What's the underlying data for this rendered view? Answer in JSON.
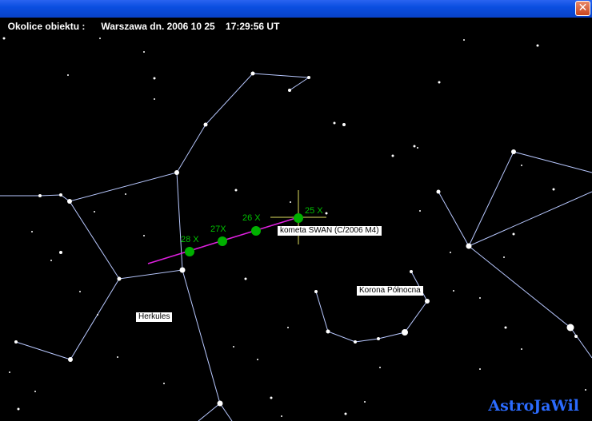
{
  "window": {
    "title_prefix": "Okolice obiektu :",
    "location": "Warszawa dn. 2006 10 25",
    "time": "17:29:56 UT",
    "close_icon": "close-icon"
  },
  "labels": {
    "comet": "kometa SWAN (C/2006 M4)",
    "constellation_hercules": "Herkules",
    "constellation_corona": "Korona Północna",
    "brand": "AstroJaWil"
  },
  "comet_track": [
    {
      "label": "28 X"
    },
    {
      "label": "27X"
    },
    {
      "label": "26 X"
    },
    {
      "label": "25 X"
    }
  ],
  "colors": {
    "sky": "#000000",
    "constellation_lines": "#b8c8ff",
    "comet_path": "#e020e0",
    "comet_marker": "#00b000",
    "crosshair": "#e0e060",
    "brand": "#2b6bff"
  }
}
